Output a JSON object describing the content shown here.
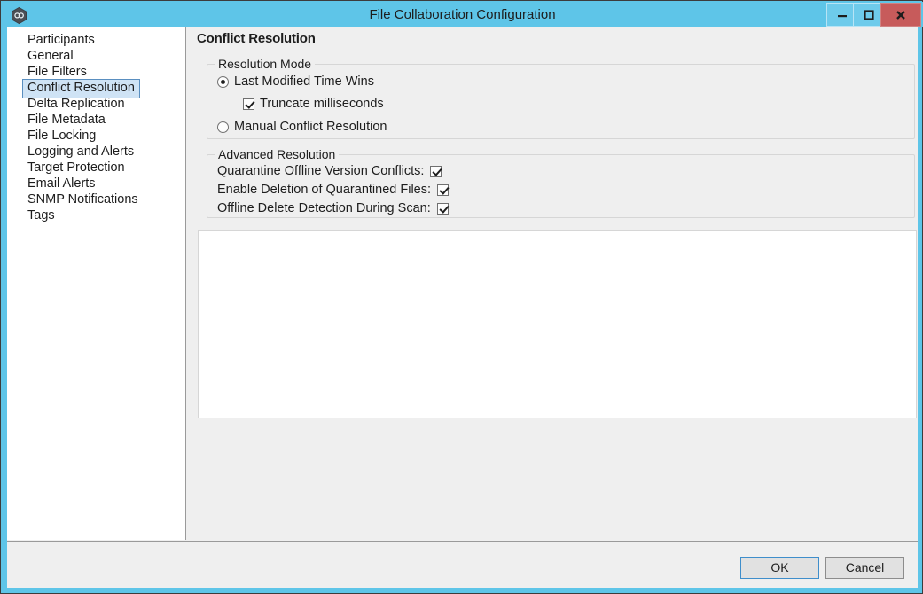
{
  "window": {
    "title": "File Collaboration Configuration",
    "icon": "app-hexagon-icon",
    "controls": {
      "minimize": "minimize-icon",
      "maximize": "maximize-icon",
      "close": "close-icon"
    }
  },
  "sidebar": {
    "items": [
      {
        "label": "Participants",
        "selected": false
      },
      {
        "label": "General",
        "selected": false
      },
      {
        "label": "File Filters",
        "selected": false
      },
      {
        "label": "Conflict Resolution",
        "selected": true
      },
      {
        "label": "Delta Replication",
        "selected": false
      },
      {
        "label": "File Metadata",
        "selected": false
      },
      {
        "label": "File Locking",
        "selected": false
      },
      {
        "label": "Logging and Alerts",
        "selected": false
      },
      {
        "label": "Target Protection",
        "selected": false
      },
      {
        "label": "Email Alerts",
        "selected": false
      },
      {
        "label": "SNMP Notifications",
        "selected": false
      },
      {
        "label": "Tags",
        "selected": false
      }
    ]
  },
  "pane": {
    "title": "Conflict Resolution",
    "resolution_mode": {
      "legend": "Resolution Mode",
      "option_last_modified": "Last Modified Time Wins",
      "option_last_modified_checked": true,
      "option_truncate_ms": "Truncate milliseconds",
      "option_truncate_ms_checked": true,
      "option_manual": "Manual Conflict Resolution",
      "option_manual_checked": false
    },
    "advanced_resolution": {
      "legend": "Advanced Resolution",
      "rows": [
        {
          "label": "Quarantine Offline Version Conflicts:",
          "checked": true
        },
        {
          "label": "Enable Deletion of Quarantined Files:",
          "checked": true
        },
        {
          "label": "Offline Delete Detection During Scan:",
          "checked": true
        }
      ]
    }
  },
  "footer": {
    "ok_label": "OK",
    "cancel_label": "Cancel"
  },
  "colors": {
    "window_frame": "#5ec5e8",
    "close_button": "#c75b5b",
    "selection_fill": "#cfe3f5",
    "selection_border": "#5a8fc0",
    "focus_border": "#3f8ecb",
    "pane_background": "#efefef"
  }
}
